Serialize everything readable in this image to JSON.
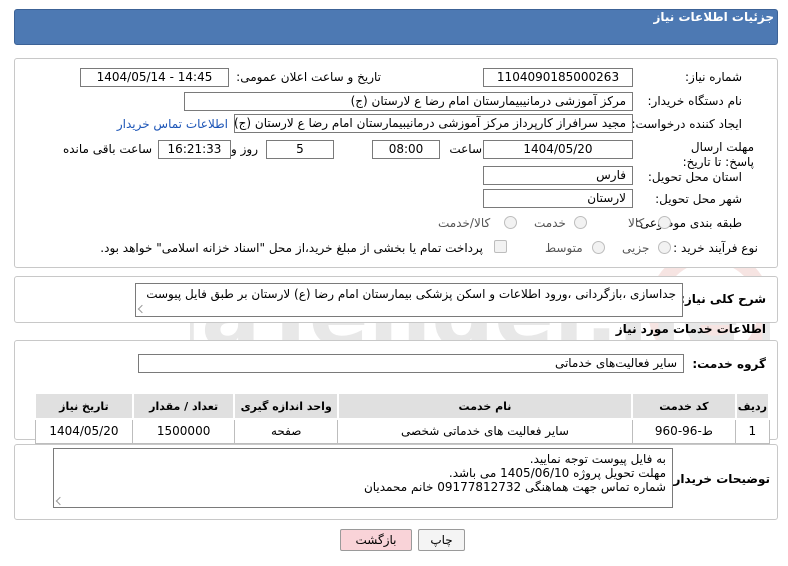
{
  "header": {
    "title": "جزئیات اطلاعات نیاز"
  },
  "fields": {
    "need_number_label": "شماره نیاز:",
    "need_number": "1104090185000263",
    "announce_datetime_label": "تاریخ و ساعت اعلان عمومی:",
    "announce_datetime": "1404/05/14 - 14:45",
    "buyer_org_label": "نام دستگاه خریدار:",
    "buyer_org": "مرکز آموزشی درمانیبیمارستان امام رضا  ع  لارستان (ج)",
    "creator_label": "ایجاد کننده درخواست:",
    "creator": "مجید سرافراز کارپرداز  مرکز آموزشی درمانیبیمارستان امام رضا  ع  لارستان (ج)",
    "buyer_contact_link": "اطلاعات تماس خریدار",
    "deadline_label": "مهلت ارسال پاسخ: تا تاریخ:",
    "deadline_date": "1404/05/20",
    "time_label": "ساعت",
    "deadline_time": "08:00",
    "days_value": "5",
    "days_label": "روز و",
    "remaining_time": "16:21:33",
    "remaining_label": "ساعت باقی مانده",
    "province_label": "استان محل تحویل:",
    "province": "فارس",
    "city_label": "شهر محل تحویل:",
    "city": "لارستان",
    "category_label": "طبقه بندی موضوعی:",
    "category_options": [
      "کالا",
      "خدمت",
      "کالا/خدمت"
    ],
    "process_label": "نوع فرآیند خرید :",
    "process_options": [
      "جزیی",
      "متوسط"
    ],
    "payment_note": "پرداخت تمام یا بخشی از مبلغ خرید،از محل \"اسناد خزانه اسلامی\" خواهد بود."
  },
  "summary": {
    "label": "شرح کلی نیاز:",
    "text": "جداسازی ،بازگردانی ،ورود اطلاعات و اسکن پزشکی بیمارستان امام رضا (ع) لارستان بر طبق فایل پیوست"
  },
  "services": {
    "section_title": "اطلاعات خدمات مورد نیاز",
    "group_label": "گروه خدمت:",
    "group_value": "سایر فعالیت‌های خدماتی",
    "columns": [
      "ردیف",
      "کد خدمت",
      "نام خدمت",
      "واحد اندازه گیری",
      "تعداد / مقدار",
      "تاریخ نیاز"
    ],
    "rows": [
      [
        "1",
        "ط-96-960",
        "سایر فعالیت های خدماتی شخصی",
        "صفحه",
        "1500000",
        "1404/05/20"
      ]
    ]
  },
  "buyer_notes": {
    "label": "توضیحات خریدار:",
    "lines": [
      "به فایل پیوست توجه نمایید.",
      "مهلت تحویل پروژه 1405/06/10 می باشد.",
      "شماره تماس جهت هماهنگی 09177812732 خانم محمدیان"
    ]
  },
  "buttons": {
    "print": "چاپ",
    "back": "بازگشت"
  },
  "watermark": {
    "text": "AriaTender.neT"
  },
  "colors": {
    "header_bg": "#4d79b3",
    "link": "#1c55b7",
    "back_btn_bg": "#f9d3d8",
    "watermark": "#c0392b"
  }
}
